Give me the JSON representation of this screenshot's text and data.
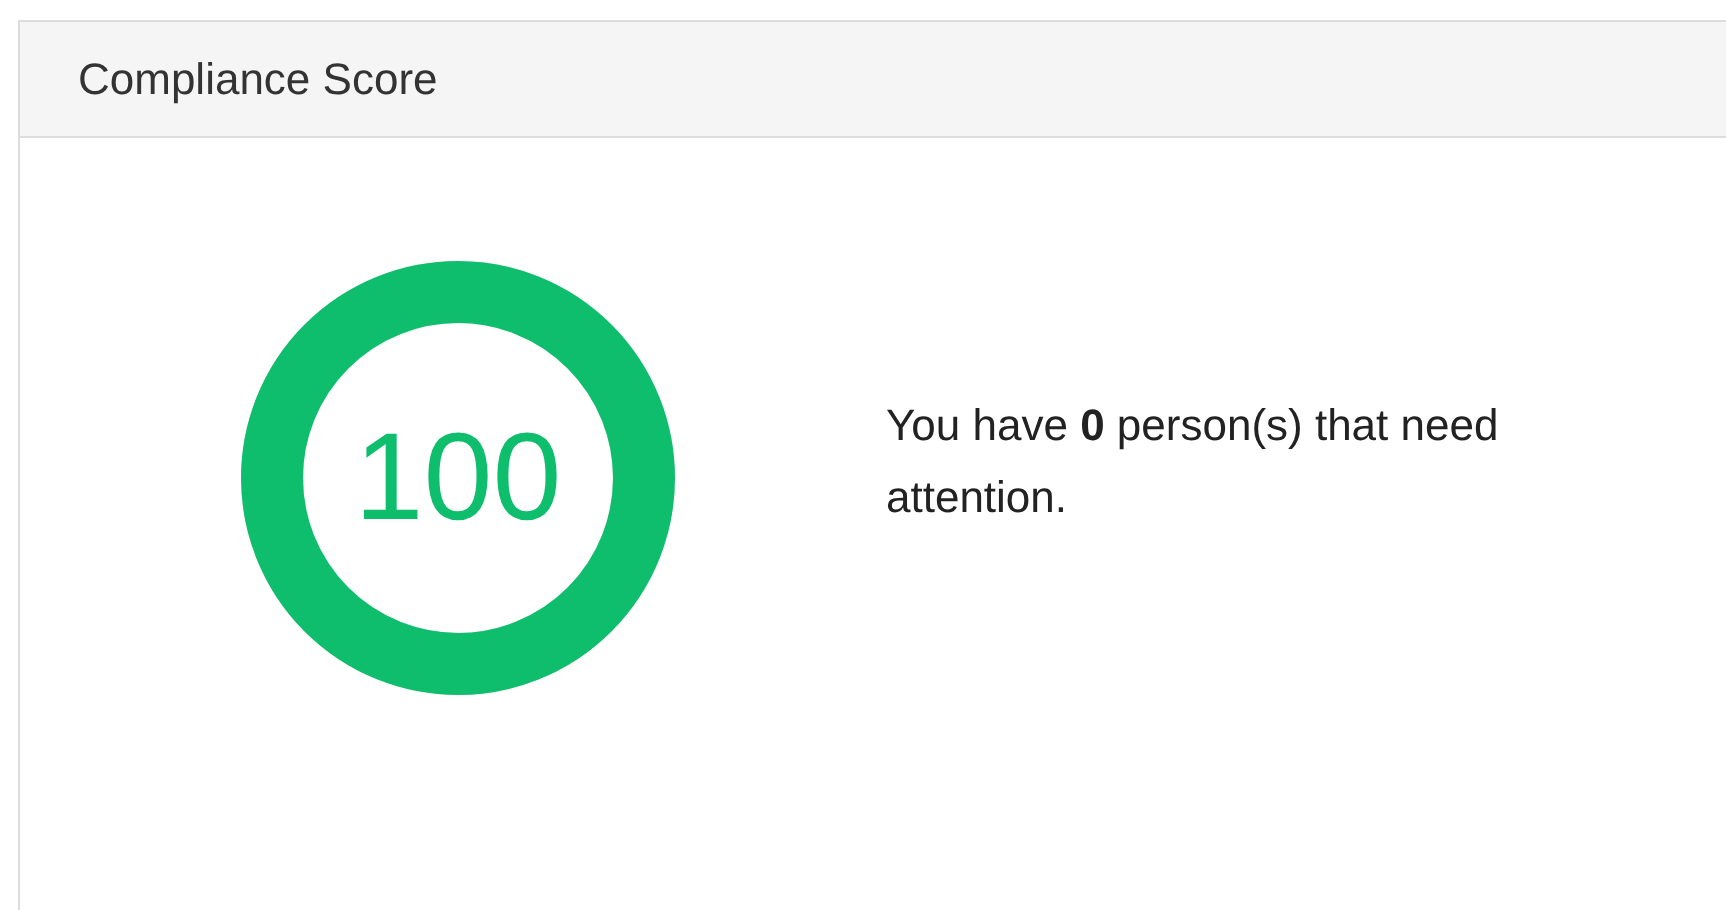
{
  "panel": {
    "title": "Compliance Score"
  },
  "score": {
    "value": "100",
    "level": 1
  },
  "message": "You have **0** person(s) that need attention."
}
